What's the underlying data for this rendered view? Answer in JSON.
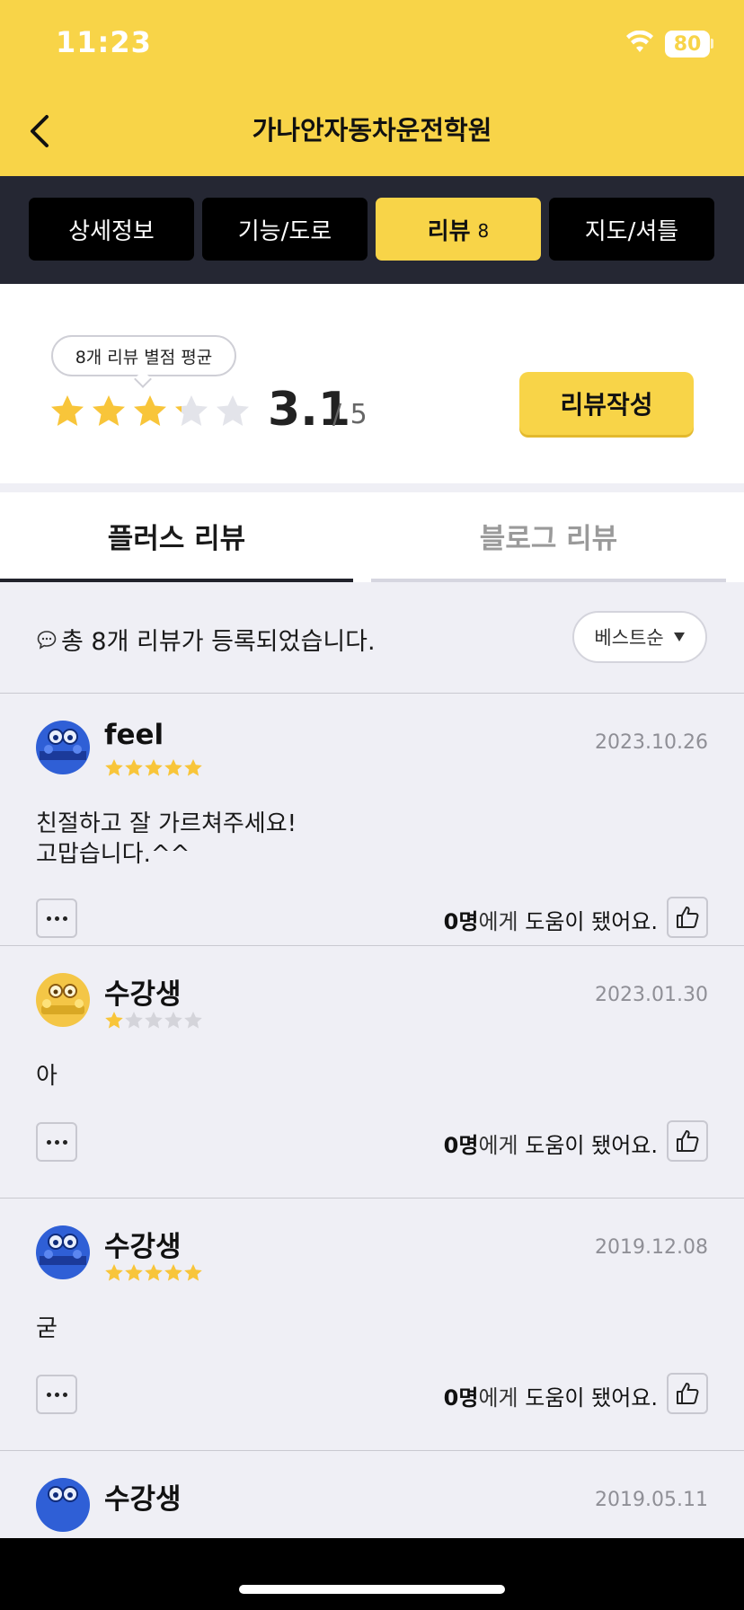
{
  "status_bar": {
    "time": "11:23",
    "battery": "80"
  },
  "header": {
    "title": "가나안자동차운전학원"
  },
  "tabs": [
    {
      "label": "상세정보"
    },
    {
      "label": "기능/도로"
    },
    {
      "label": "리뷰",
      "count": "8"
    },
    {
      "label": "지도/셔틀"
    }
  ],
  "summary": {
    "bubble": "8개 리뷰 별점 평균",
    "rating": "3.1",
    "rating_max": "/ 5",
    "stars_filled_fraction": 0.62,
    "write_button": "리뷰작성"
  },
  "subtabs": [
    {
      "label": "플러스 리뷰"
    },
    {
      "label": "블로그 리뷰"
    }
  ],
  "count_bar": {
    "text": "총 8개 리뷰가 등록되었습니다.",
    "sort": "베스트순"
  },
  "reviews": [
    {
      "name": "feel",
      "stars": 5,
      "date": "2023.10.26",
      "body": "친절하고 잘 가르쳐주세요!\n고맙습니다.^^",
      "helpful_count": "0명",
      "helpful_suffix": "에게 ",
      "helpful_text": "도움이 됐어요.",
      "avatar": "blue"
    },
    {
      "name": "수강생",
      "stars": 1,
      "date": "2023.01.30",
      "body": "아",
      "helpful_count": "0명",
      "helpful_suffix": "에게 ",
      "helpful_text": "도움이 됐어요.",
      "avatar": "yellow"
    },
    {
      "name": "수강생",
      "stars": 5,
      "date": "2019.12.08",
      "body": "굳",
      "helpful_count": "0명",
      "helpful_suffix": "에게 ",
      "helpful_text": "도움이 됐어요.",
      "avatar": "blue"
    },
    {
      "name": "수강생",
      "date": "2019.05.11",
      "avatar": "blue"
    }
  ],
  "colors": {
    "brand_yellow": "#f8d448",
    "dark_tabs": "#252733",
    "star_empty": "#e3e4ea"
  }
}
